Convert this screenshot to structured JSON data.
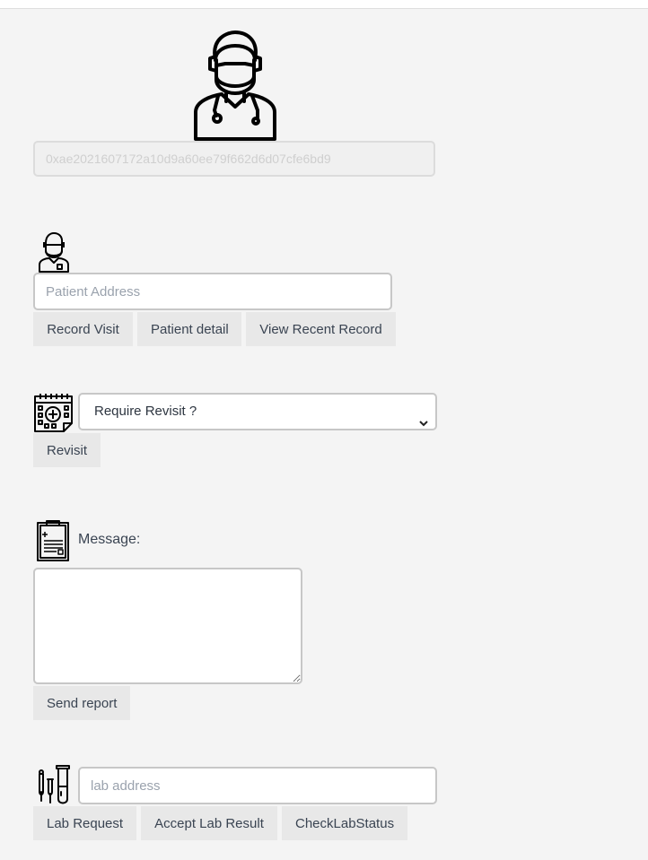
{
  "doctor": {
    "address": "0xae2021607172a10d9a60ee79f662d6d07cfe6bd9",
    "avatar_icon": "doctor-mask-stethoscope-icon"
  },
  "patient": {
    "icon": "patient-mask-icon",
    "address_placeholder": "Patient Address",
    "buttons": {
      "record_visit": "Record Visit",
      "patient_detail": "Patient detail",
      "view_recent_record": "View Recent Record"
    }
  },
  "revisit": {
    "icon": "calendar-icon",
    "select_value": "Require Revisit ?",
    "button": "Revisit"
  },
  "report": {
    "icon": "clipboard-report-icon",
    "message_label": "Message:",
    "message_value": "",
    "send_button": "Send report"
  },
  "lab": {
    "icon": "test-tubes-icon",
    "address_placeholder": "lab address",
    "buttons": {
      "lab_request": "Lab Request",
      "accept_lab_result": "Accept Lab Result",
      "check_lab_status": "CheckLabStatus"
    }
  },
  "colors": {
    "background": "#f4f4f4",
    "button_bg": "#e8e8e8",
    "text": "#3a4452",
    "input_border": "#c7c7c7"
  }
}
